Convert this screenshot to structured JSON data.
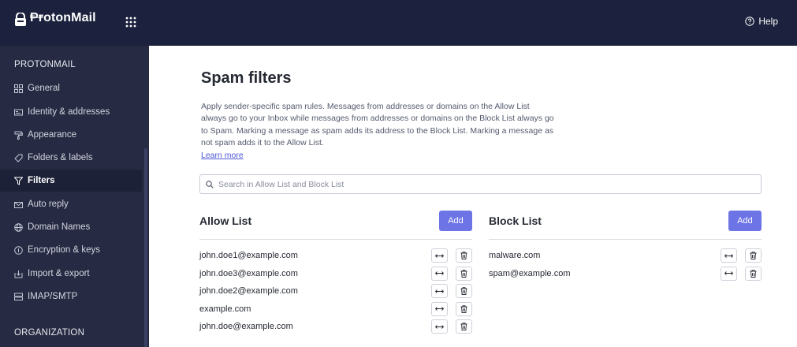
{
  "app": {
    "logo_text": "ProtonMail",
    "logo_sub": "PLUS",
    "help_label": "Help"
  },
  "sidebar": {
    "section1": "PROTONMAIL",
    "items": [
      {
        "label": "General",
        "icon": "grid-icon"
      },
      {
        "label": "Identity & addresses",
        "icon": "id-card-icon"
      },
      {
        "label": "Appearance",
        "icon": "paint-roller-icon"
      },
      {
        "label": "Folders & labels",
        "icon": "tag-icon"
      },
      {
        "label": "Filters",
        "icon": "filter-icon",
        "active": true
      },
      {
        "label": "Auto reply",
        "icon": "envelope-reply-icon"
      },
      {
        "label": "Domain Names",
        "icon": "globe-icon"
      },
      {
        "label": "Encryption & keys",
        "icon": "key-icon"
      },
      {
        "label": "Import & export",
        "icon": "import-export-icon"
      },
      {
        "label": "IMAP/SMTP",
        "icon": "server-icon"
      }
    ],
    "section2": "ORGANIZATION"
  },
  "main": {
    "title": "Spam filters",
    "description": "Apply sender-specific spam rules. Messages from addresses or domains on the Allow List always go to your Inbox while messages from addresses or domains on the Block List always go to Spam. Marking a message as spam adds its address to the Block List. Marking a message as not spam adds it to the Allow List.",
    "learn_more": "Learn more",
    "search_placeholder": "Search in Allow List and Block List",
    "search_value": "",
    "allow_list": {
      "title": "Allow List",
      "add_label": "Add",
      "entries": [
        "john.doe1@example.com",
        "john.doe3@example.com",
        "john.doe2@example.com",
        "example.com",
        "john.doe@example.com"
      ]
    },
    "block_list": {
      "title": "Block List",
      "add_label": "Add",
      "entries": [
        "malware.com",
        "spam@example.com"
      ]
    }
  },
  "colors": {
    "topbar": "#1c223d",
    "sidebar": "#262a42",
    "accent": "#6d74e6",
    "link": "#4e57d8"
  }
}
